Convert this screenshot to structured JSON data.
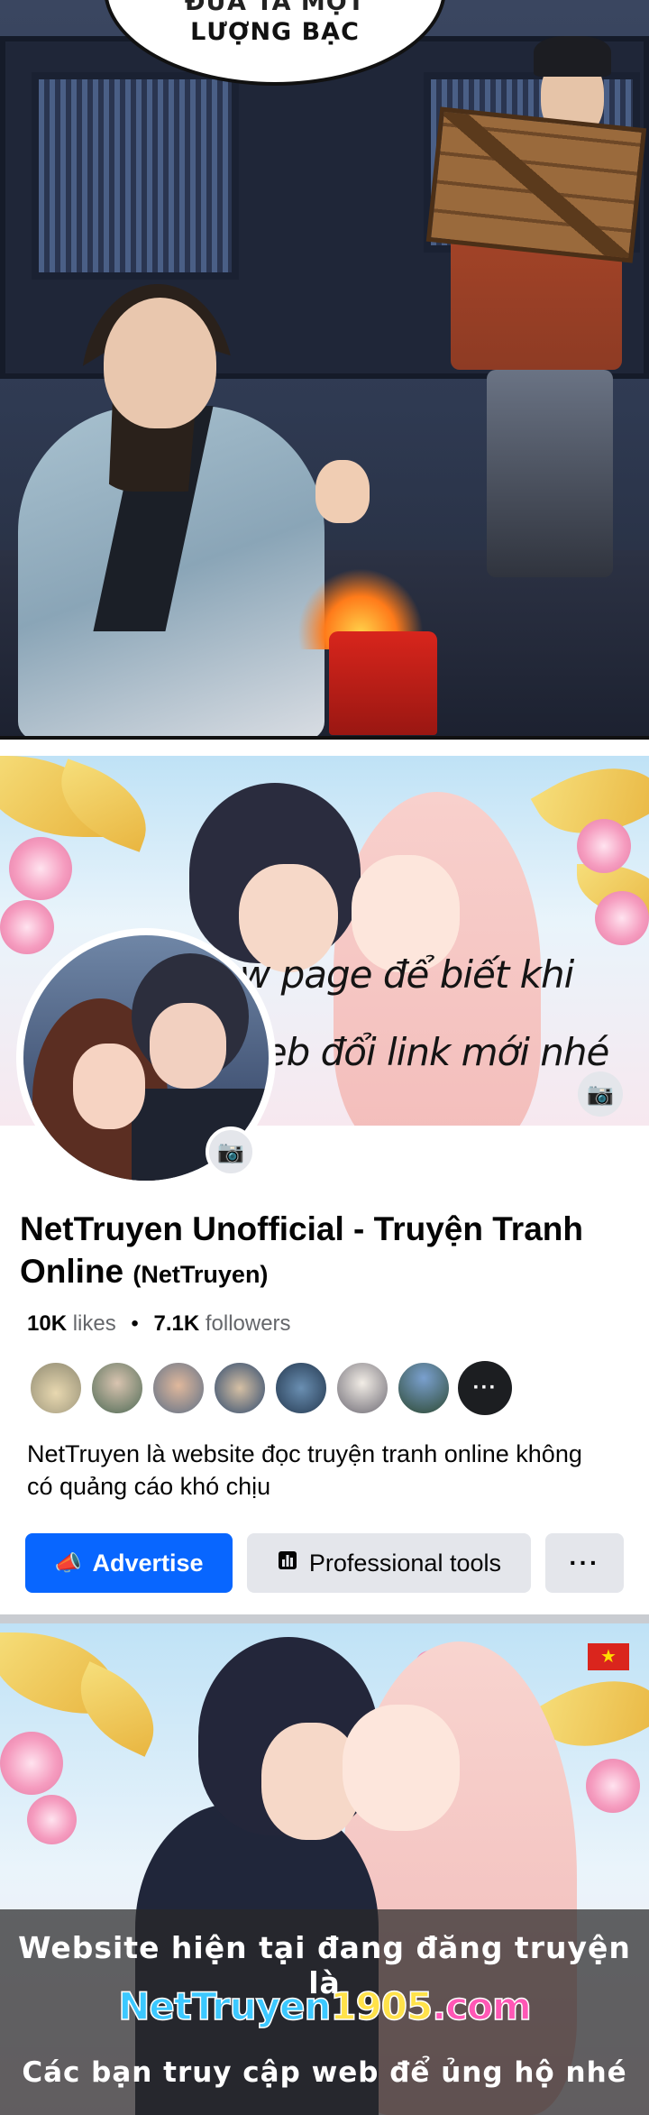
{
  "comic": {
    "speech_line1": "ĐƯA TA MỘT",
    "speech_line2": "LƯỢNG BẠC"
  },
  "cover": {
    "caption_line1": "Follow page để biết khi",
    "caption_line2": "nào web đổi link mới nhé",
    "camera_icon": "camera-icon"
  },
  "page": {
    "name": "NetTruyen Unofficial - Truyện Tranh Online",
    "handle": "(NetTruyen)",
    "likes_count": "10K",
    "likes_label": "likes",
    "followers_count": "7.1K",
    "followers_label": "followers",
    "bio": "NetTruyen là website đọc truyện tranh online không có quảng cáo khó chịu",
    "more_friends": "···"
  },
  "actions": {
    "advertise": "Advertise",
    "professional_tools": "Professional tools",
    "more": "···"
  },
  "banner": {
    "line1": "Website hiện tại đang đăng truyện là",
    "site_part1": "NetTruyen",
    "site_part2": "1905",
    "site_part3": ".com",
    "line3": "Các bạn truy cập web để ủng hộ nhé",
    "flag_star": "★"
  },
  "colors": {
    "fb_blue": "#0866ff",
    "button_gray": "#e4e6eb",
    "text_dark": "#050505",
    "text_muted": "#65676b"
  }
}
